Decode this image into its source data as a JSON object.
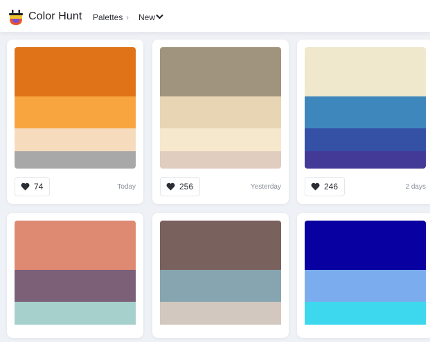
{
  "header": {
    "brand": "Color Hunt",
    "breadcrumb": [
      "Palettes",
      "New"
    ],
    "separator": "›",
    "logo_icon": "color-hunt-logo-icon",
    "dropdown_icon": "chevron-down-icon"
  },
  "palettes": [
    {
      "colors": [
        "#E07218",
        "#F8A540",
        "#F6DBBC",
        "#A8A8A8"
      ],
      "likes": "74",
      "when": "Today"
    },
    {
      "colors": [
        "#A0947E",
        "#E8D5B4",
        "#F6E8CC",
        "#E1CCC0"
      ],
      "likes": "256",
      "when": "Yesterday"
    },
    {
      "colors": [
        "#EFE8CD",
        "#3E87BC",
        "#3451A6",
        "#433A97"
      ],
      "likes": "246",
      "when": "2 days"
    },
    {
      "colors": [
        "#DE8A72",
        "#7B6078",
        "#A6D0CB"
      ],
      "likes": "",
      "when": ""
    },
    {
      "colors": [
        "#79615E",
        "#87A5B0",
        "#D2C8BF"
      ],
      "likes": "",
      "when": ""
    },
    {
      "colors": [
        "#0800A0",
        "#7AACEE",
        "#3ED8EE"
      ],
      "likes": "",
      "when": ""
    }
  ]
}
